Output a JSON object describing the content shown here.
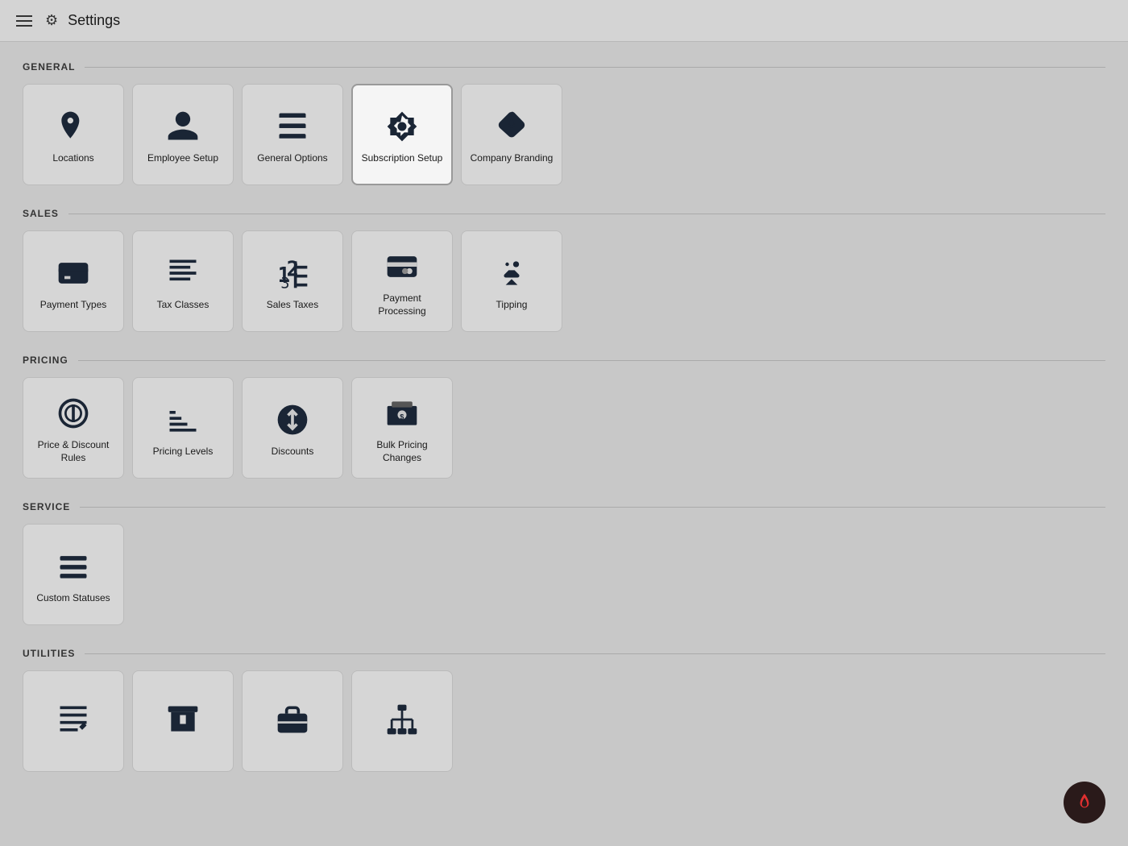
{
  "header": {
    "title": "Settings",
    "menu_label": "Menu",
    "gear_label": "Settings icon"
  },
  "sections": [
    {
      "id": "general",
      "label": "GENERAL",
      "tiles": [
        {
          "id": "locations",
          "label": "Locations",
          "icon": "locations",
          "active": false
        },
        {
          "id": "employee-setup",
          "label": "Employee Setup",
          "icon": "employee",
          "active": false
        },
        {
          "id": "general-options",
          "label": "General Options",
          "icon": "general-options",
          "active": false
        },
        {
          "id": "subscription-setup",
          "label": "Subscription Setup",
          "icon": "subscription",
          "active": true
        },
        {
          "id": "company-branding",
          "label": "Company Branding",
          "icon": "branding",
          "active": false
        }
      ]
    },
    {
      "id": "sales",
      "label": "SALES",
      "tiles": [
        {
          "id": "payment-types",
          "label": "Payment Types",
          "icon": "payment-types",
          "active": false
        },
        {
          "id": "tax-classes",
          "label": "Tax Classes",
          "icon": "tax-classes",
          "active": false
        },
        {
          "id": "sales-taxes",
          "label": "Sales Taxes",
          "icon": "sales-taxes",
          "active": false
        },
        {
          "id": "payment-processing",
          "label": "Payment Processing",
          "icon": "payment-processing",
          "active": false
        },
        {
          "id": "tipping",
          "label": "Tipping",
          "icon": "tipping",
          "active": false
        }
      ]
    },
    {
      "id": "pricing",
      "label": "PRICING",
      "tiles": [
        {
          "id": "price-discount-rules",
          "label": "Price & Discount Rules",
          "icon": "price-discount",
          "active": false
        },
        {
          "id": "pricing-levels",
          "label": "Pricing Levels",
          "icon": "pricing-levels",
          "active": false
        },
        {
          "id": "discounts",
          "label": "Discounts",
          "icon": "discounts",
          "active": false
        },
        {
          "id": "bulk-pricing",
          "label": "Bulk Pricing Changes",
          "icon": "bulk-pricing",
          "active": false
        }
      ]
    },
    {
      "id": "service",
      "label": "SERVICE",
      "tiles": [
        {
          "id": "custom-statuses",
          "label": "Custom Statuses",
          "icon": "custom-statuses",
          "active": false
        }
      ]
    },
    {
      "id": "utilities",
      "label": "UTILITIES",
      "tiles": [
        {
          "id": "utility-1",
          "label": "",
          "icon": "edit-doc",
          "active": false
        },
        {
          "id": "utility-2",
          "label": "",
          "icon": "archive",
          "active": false
        },
        {
          "id": "utility-3",
          "label": "",
          "icon": "briefcase",
          "active": false
        },
        {
          "id": "utility-4",
          "label": "",
          "icon": "hierarchy",
          "active": false
        }
      ]
    }
  ],
  "fab": {
    "label": "Flame icon"
  }
}
